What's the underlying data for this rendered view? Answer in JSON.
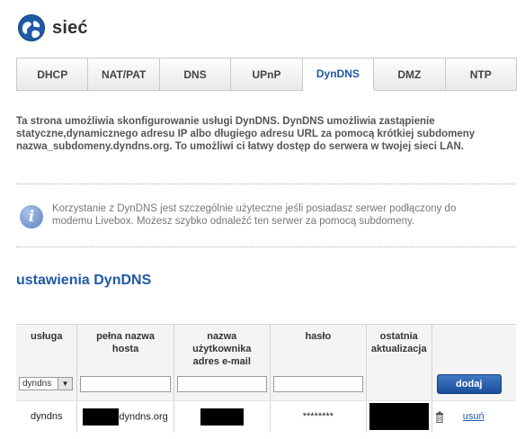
{
  "header": {
    "title": "sieć",
    "logo_icon": "globe-icon"
  },
  "tabs": [
    {
      "label": "DHCP"
    },
    {
      "label": "NAT/PAT"
    },
    {
      "label": "DNS"
    },
    {
      "label": "UPnP"
    },
    {
      "label": "DynDNS",
      "active": true
    },
    {
      "label": "DMZ"
    },
    {
      "label": "NTP"
    }
  ],
  "intro": {
    "line1": "Ta strona umożliwia skonfigurowanie usługi DynDNS. DynDNS umożliwia zastąpienie",
    "line2": "statyczne,dynamicznego adresu IP albo długiego adresu URL za pomocą krótkiej subdomeny",
    "line3": "nazwa_subdomeny.dyndns.org. To umożliwi ci łatwy dostęp do serwera w twojej sieci LAN."
  },
  "info": {
    "icon": "info-icon",
    "line1": "Korzystanie z DynDNS jest szczególnie użyteczne jeśli posiadasz serwer podłączony do",
    "line2": "modemu Livebox. Możesz szybko odnaleźć ten serwer za pomocą subdomeny."
  },
  "section": {
    "title": "ustawienia DynDNS"
  },
  "table": {
    "headers": {
      "service": "usługa",
      "host_l1": "pełna nazwa",
      "host_l2": "hosta",
      "user_l1": "nazwa",
      "user_l2": "użytkownika",
      "user_l3": "adres e-mail",
      "password": "hasło",
      "update_l1": "ostatnia",
      "update_l2": "aktualizacja"
    },
    "input_row": {
      "service_selected": "dyndns",
      "host_value": "",
      "user_value": "",
      "password_value": "",
      "add_label": "dodaj"
    },
    "data_row": {
      "service": "dyndns",
      "host_suffix": "dyndns.org",
      "password": "********",
      "delete_icon": "trash-icon",
      "remove_label": "usuń"
    }
  },
  "colors": {
    "accent": "#1f5aa6",
    "button": "#2a60ae"
  }
}
